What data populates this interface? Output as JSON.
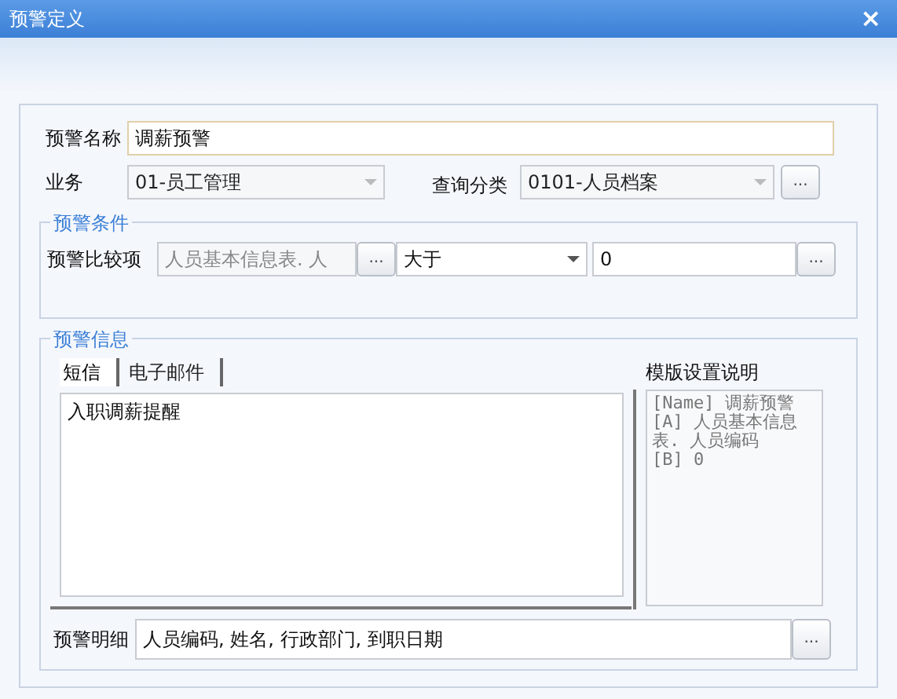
{
  "window": {
    "title": "预警定义",
    "close": "×"
  },
  "name_field": {
    "label": "预警名称",
    "value": "调薪预警"
  },
  "business": {
    "label": "业务",
    "value": "01-员工管理",
    "disabled": true
  },
  "query_category": {
    "label": "查询分类",
    "value": "0101-人员档案",
    "disabled": true,
    "button": "..."
  },
  "condition": {
    "legend": "预警条件",
    "label": "预警比较项",
    "field": "人员基本信息表. 人",
    "field_button": "...",
    "operator": "大于",
    "value": "0",
    "value_button": "..."
  },
  "info": {
    "legend": "预警信息",
    "tabs": [
      {
        "label": "短信",
        "selected": true
      },
      {
        "label": "电子邮件",
        "selected": false
      }
    ],
    "message": "入职调薪提醒",
    "template_title": "模版设置说明",
    "template_lines": [
      "[Name] 调薪预警",
      "[A] 人员基本信息表. 人员编码",
      "[B] 0"
    ],
    "detail_label": "预警明细",
    "detail_value": "人员编码, 姓名, 行政部门, 到职日期",
    "detail_button": "..."
  }
}
